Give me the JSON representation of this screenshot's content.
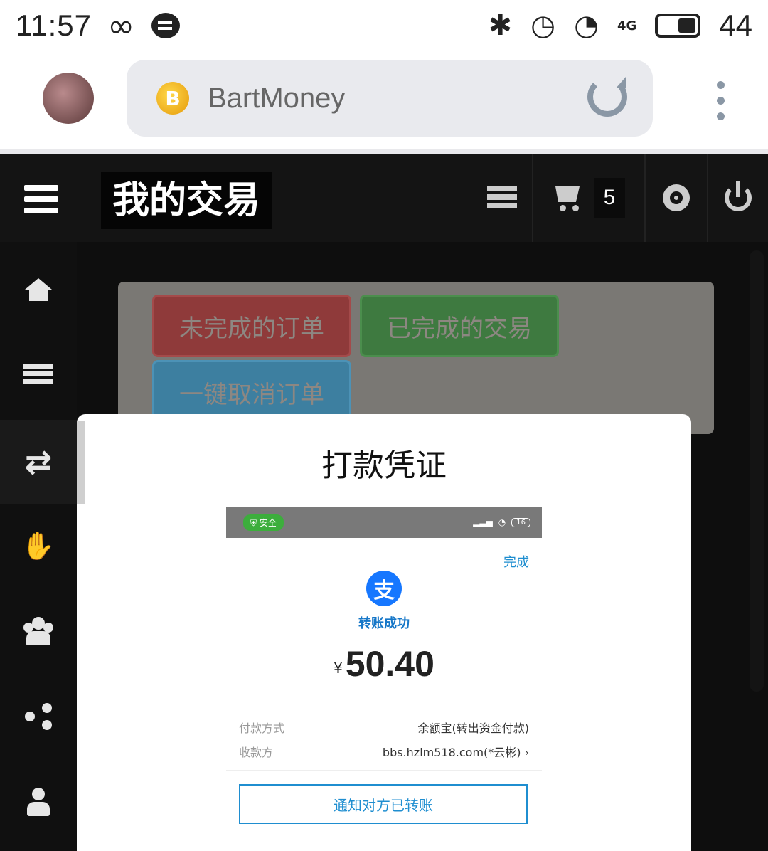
{
  "status_bar": {
    "time": "11:57",
    "infinity": "∞",
    "signal_label": "4G",
    "battery": "44"
  },
  "browser": {
    "site_logo": "B",
    "url": "BartMoney"
  },
  "header": {
    "title": "我的交易",
    "cart_count": "5"
  },
  "panel": {
    "btn_unfinished": "未完成的订单",
    "btn_finished": "已完成的交易",
    "btn_cancel_all": "一键取消订单"
  },
  "modal": {
    "title": "打款凭证",
    "receipt": {
      "safe_badge": "安全",
      "battery": "16",
      "done": "完成",
      "icon_char": "支",
      "success": "转账成功",
      "currency": "¥",
      "amount": "50.40",
      "pay_method_label": "付款方式",
      "pay_method_value": "余额宝(转出资金付款)",
      "payee_label": "收款方",
      "payee_value": "bbs.hzlm518.com(*云彬) ›",
      "notify_button": "通知对方已转账"
    }
  },
  "colors": {
    "header_bg": "#141414",
    "panel_bg": "#7a7874",
    "btn_red": "#8f3a3a",
    "btn_green": "#3e7a40",
    "btn_blue": "#3d7fa0",
    "alipay_blue": "#1677ff"
  }
}
